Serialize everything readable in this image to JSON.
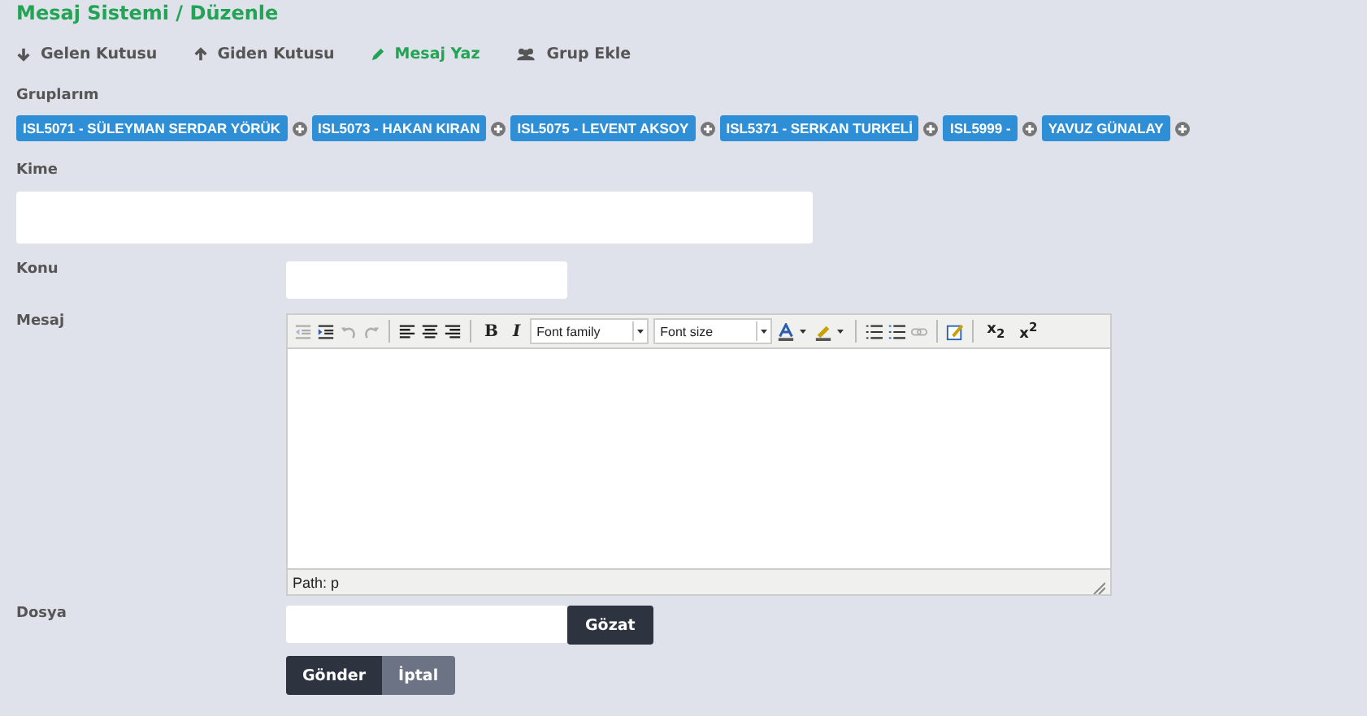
{
  "title": "Mesaj Sistemi / Düzenle",
  "nav": [
    {
      "kind": "down",
      "label": "Gelen Kutusu",
      "selected": false
    },
    {
      "kind": "up",
      "label": "Giden Kutusu",
      "selected": false
    },
    {
      "kind": "pencil",
      "label": "Mesaj Yaz",
      "selected": true
    },
    {
      "kind": "users",
      "label": "Grup Ekle",
      "selected": false
    }
  ],
  "groups_label": "Gruplarım",
  "groups": [
    "ISL5071 - SÜLEYMAN SERDAR YÖRÜK",
    "ISL5073 - HAKAN KIRAN",
    "ISL5075 - LEVENT AKSOY",
    "ISL5371 - SERKAN TURKELİ",
    "ISL5999 -",
    "YAVUZ GÜNALAY"
  ],
  "kime_label": "Kime",
  "konu_label": "Konu",
  "mesaj_label": "Mesaj",
  "toolbar": [
    {
      "kind": "outdent",
      "disabled": true
    },
    {
      "kind": "indent",
      "disabled": false
    },
    {
      "kind": "undo",
      "disabled": true
    },
    {
      "kind": "redo",
      "disabled": true
    },
    {
      "kind": "sep"
    },
    {
      "kind": "align-left",
      "disabled": false
    },
    {
      "kind": "align-center",
      "disabled": false
    },
    {
      "kind": "align-right",
      "disabled": false
    },
    {
      "kind": "sep"
    },
    {
      "kind": "text",
      "label": "B",
      "disabled": false
    },
    {
      "kind": "text-italic",
      "label": "I",
      "disabled": false
    },
    {
      "kind": "select",
      "label": "Font family"
    },
    {
      "kind": "select",
      "label": "Font size"
    },
    {
      "kind": "font-color",
      "disabled": false
    },
    {
      "kind": "highlight",
      "disabled": false
    },
    {
      "kind": "sep"
    },
    {
      "kind": "bullets",
      "disabled": false
    },
    {
      "kind": "numbers",
      "disabled": false
    },
    {
      "kind": "link",
      "disabled": true
    },
    {
      "kind": "sep"
    },
    {
      "kind": "edit",
      "disabled": false
    },
    {
      "kind": "sep"
    },
    {
      "kind": "rich",
      "label": "x$_{2}$",
      "disabled": false
    },
    {
      "kind": "rich",
      "label": "x$^{2}$",
      "disabled": false
    }
  ],
  "path": "Path: p",
  "dosya_label": "Dosya",
  "browse": "Gözat",
  "buttons": [
    {
      "label": "Gönder",
      "kind": "primary"
    },
    {
      "label": "İptal",
      "kind": "secondary"
    }
  ]
}
